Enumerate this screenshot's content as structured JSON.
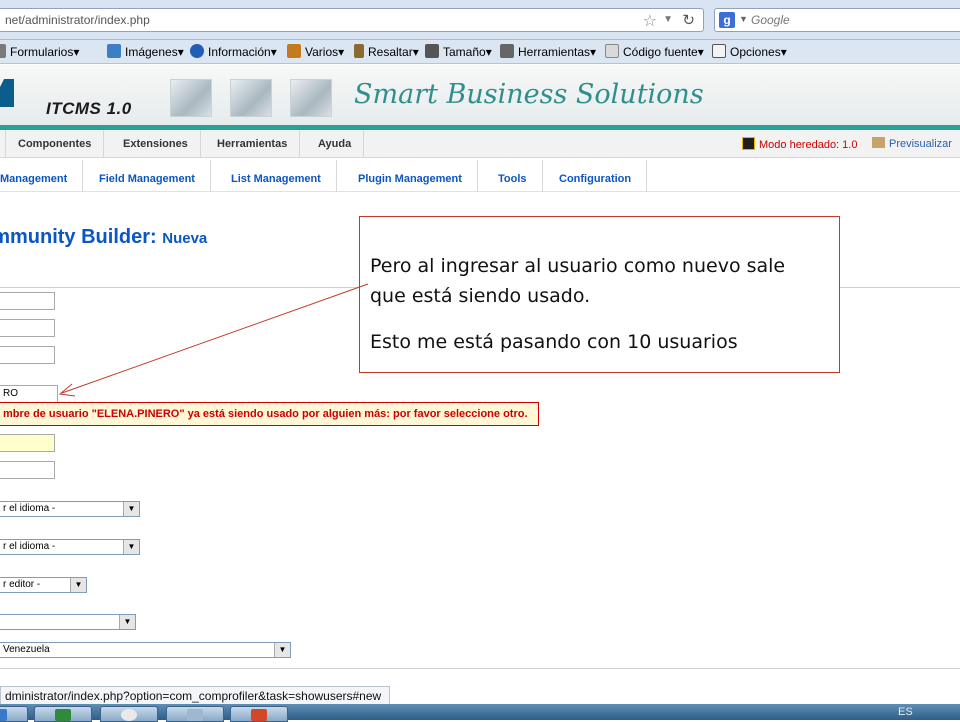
{
  "browser": {
    "url": "net/administrator/index.php",
    "search_engine": "Google"
  },
  "dev_toolbar": {
    "items": [
      "Formularios",
      "Imágenes",
      "Información",
      "Varios",
      "Resaltar",
      "Tamaño",
      "Herramientas",
      "Código fuente",
      "Opciones"
    ]
  },
  "cms": {
    "product": "ITCMS 1.0",
    "slogan": "Smart Business Solutions",
    "main_menu": [
      "Componentes",
      "Extensiones",
      "Herramientas",
      "Ayuda"
    ],
    "legacy_mode": "Modo heredado: 1.0",
    "preview": "Previsualizar",
    "submenu": [
      "Management",
      "Field Management",
      "List Management",
      "Plugin Management",
      "Tools",
      "Configuration"
    ],
    "title": "ommunity Builder:",
    "title_sub": "Nueva"
  },
  "form": {
    "username_value": "RO",
    "error_message": "mbre de usuario \"ELENA.PINERO\" ya está siendo usado por alguien más: por favor seleccione otro.",
    "select_language_1": "r el idioma -",
    "select_language_2": "r el idioma -",
    "select_editor": "r editor -",
    "select_country": "Venezuela"
  },
  "annotation": {
    "line1": "Pero al ingresar al usuario como nuevo sale",
    "line2": "que está siendo usado.",
    "line3": "Esto me está pasando con 10 usuarios"
  },
  "status_bar": "dministrator/index.php?option=com_comprofiler&task=showusers#new",
  "taskbar": {
    "tray_text": "ES"
  },
  "colors": {
    "accent_teal": "#2aa198",
    "link_blue": "#0b55c4",
    "error_red": "#cc0000"
  }
}
